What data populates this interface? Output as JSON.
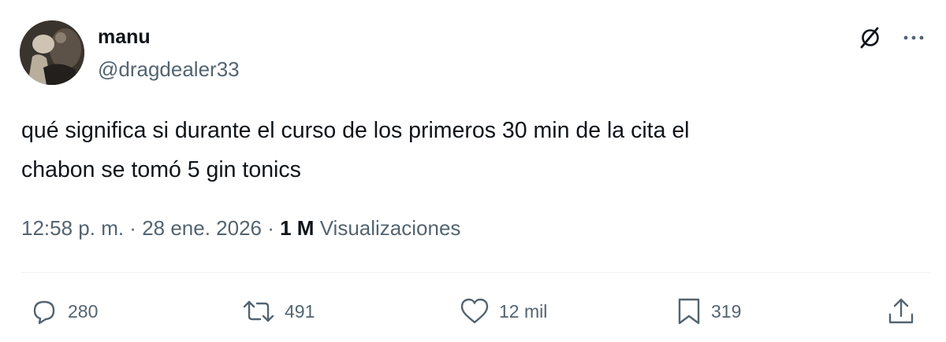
{
  "author": {
    "display_name": "manu",
    "handle": "@dragdealer33"
  },
  "tweet": {
    "text": "qué significa si durante el curso de los primeros 30 min de la cita el\nchabon se tomó 5 gin tonics"
  },
  "meta": {
    "time": "12:58 p. m.",
    "separator": " · ",
    "date": "28 ene. 2026",
    "views_count": "1 M",
    "views_label": "Visualizaciones"
  },
  "actions": {
    "reply": {
      "icon": "reply-icon",
      "count": "280"
    },
    "retweet": {
      "icon": "retweet-icon",
      "count": "491"
    },
    "like": {
      "icon": "heart-icon",
      "count": "12 mil"
    },
    "bookmark": {
      "icon": "bookmark-icon",
      "count": "319"
    },
    "share": {
      "icon": "share-icon"
    }
  },
  "header_icons": {
    "grok": "grok-icon",
    "more": "more-icon"
  },
  "colors": {
    "text_primary": "#0f1419",
    "text_secondary": "#536471",
    "divider": "#eff3f4"
  }
}
